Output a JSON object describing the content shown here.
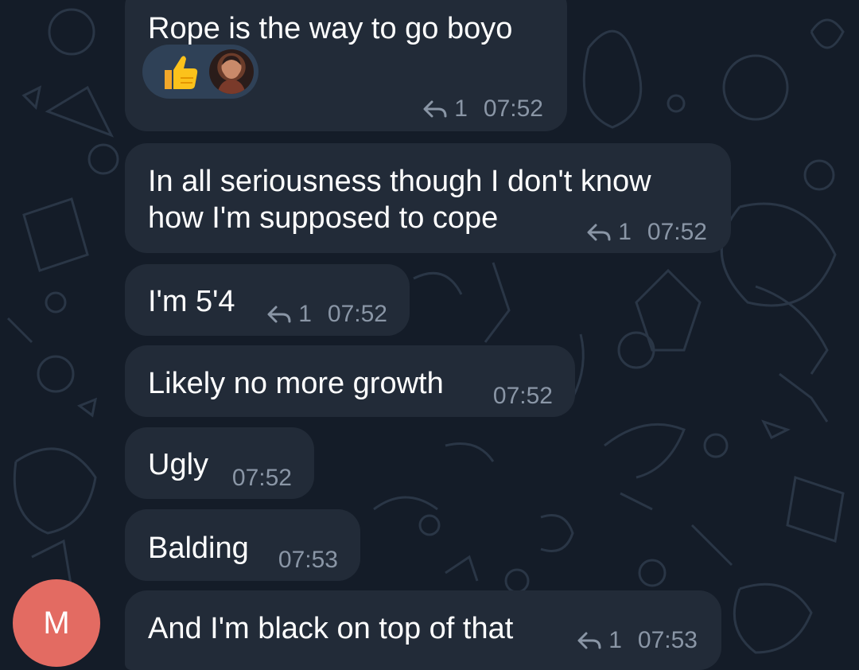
{
  "chat": {
    "messages": [
      {
        "text": "Rope is the way to go boyo",
        "reply_count": "1",
        "time": "07:52",
        "reactions": [
          {
            "icon": "thumbs-up-emoji"
          },
          {
            "icon": "user-avatar-reaction"
          }
        ]
      },
      {
        "text": "In all seriousness though I don't know\nhow I'm supposed to cope",
        "reply_count": "1",
        "time": "07:52"
      },
      {
        "text": "I'm 5'4",
        "reply_count": "1",
        "time": "07:52"
      },
      {
        "text": "Likely no more growth",
        "time": "07:52"
      },
      {
        "text": "Ugly",
        "time": "07:52"
      },
      {
        "text": "Balding",
        "time": "07:53"
      },
      {
        "text": "And I'm black on top of that",
        "reply_count": "1",
        "time": "07:53"
      }
    ],
    "sender_avatar_initial": "M"
  },
  "colors": {
    "background": "#141c28",
    "bubble": "#222b38",
    "meta_text": "#8a96a6",
    "avatar": "#e36b62",
    "reaction_pill": "#2f4157"
  },
  "icons": {
    "reply": "reply-arrow-icon"
  }
}
